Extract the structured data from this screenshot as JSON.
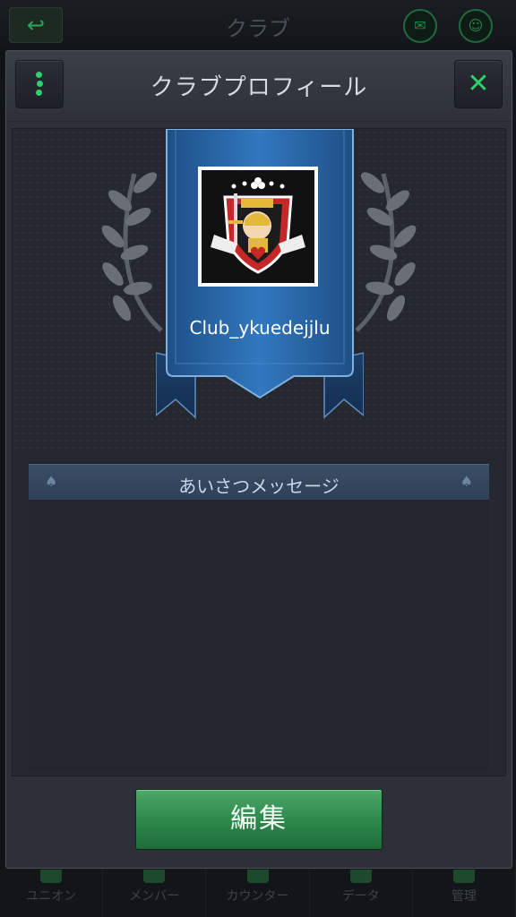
{
  "background": {
    "title": "クラブ",
    "back_icon": "back-arrow-icon",
    "tabs": [
      {
        "label": "ユニオン"
      },
      {
        "label": "メンバー"
      },
      {
        "label": "カウンター"
      },
      {
        "label": "データ"
      },
      {
        "label": "管理"
      }
    ]
  },
  "modal": {
    "title": "クラブプロフィール",
    "menu_icon": "dots-menu-icon",
    "close_icon": "close-icon",
    "close_glyph": "✕"
  },
  "club": {
    "name": "Club_ykuedejjlu",
    "logo": "jack-playing-card-logo"
  },
  "greeting": {
    "title": "あいさつメッセージ",
    "message": ""
  },
  "actions": {
    "edit_label": "編集"
  },
  "colors": {
    "accent_green": "#2fd06a",
    "ribbon_blue": "#2f6fb0",
    "button_green": "#2e8a4c"
  }
}
